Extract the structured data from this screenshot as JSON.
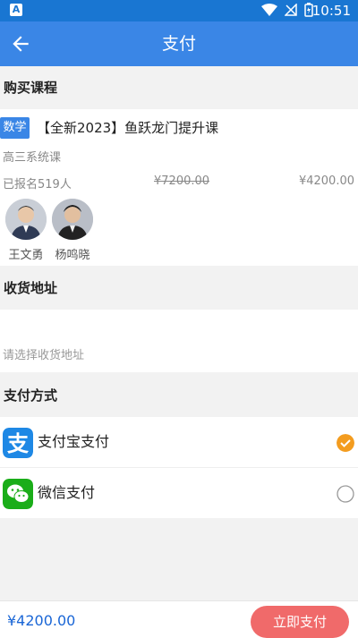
{
  "status_bar": {
    "time": "10:51",
    "app_icon": "A"
  },
  "header": {
    "title": "支付"
  },
  "sections": {
    "course": "购买课程",
    "address": "收货地址",
    "payment": "支付方式"
  },
  "course": {
    "subject_tag": "数学",
    "title": "【全新2023】鱼跃龙门提升课",
    "subtitle": "高三系统课",
    "enrolled": "已报名519人",
    "original_price": "¥7200.00",
    "price": "¥4200.00",
    "teachers": [
      {
        "name": "王文勇"
      },
      {
        "name": "杨鸣晓"
      }
    ]
  },
  "address": {
    "placeholder": "请选择收货地址"
  },
  "payment_methods": [
    {
      "label": "支付宝支付",
      "selected": true
    },
    {
      "label": "微信支付",
      "selected": false
    }
  ],
  "footer": {
    "total": "¥4200.00",
    "pay_button": "立即支付"
  },
  "colors": {
    "primary": "#3a86e6",
    "accent": "#f39c1f",
    "pay_button": "#f06a6a",
    "price": "#1a66d6"
  }
}
